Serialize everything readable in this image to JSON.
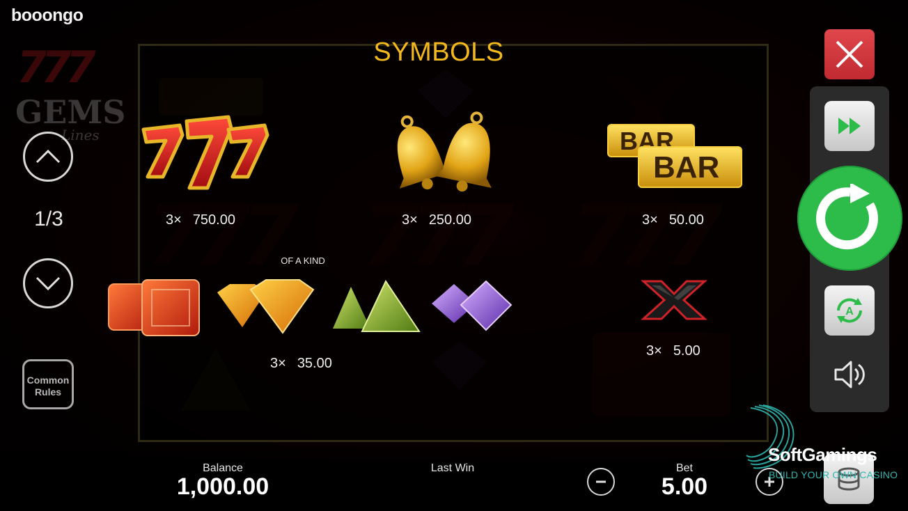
{
  "brand": {
    "provider_logo": "booongo"
  },
  "game_logo": {
    "top": "777",
    "middle": "GEMS",
    "bottom": "Lines"
  },
  "title": "SYMBOLS",
  "navigation": {
    "page_indicator": "1/3",
    "up_icon": "chevron-up-icon",
    "down_icon": "chevron-down-icon",
    "common_rules_line1": "Common",
    "common_rules_line2": "Rules"
  },
  "symbols": [
    {
      "id": "sevens",
      "icon": "sevens-icon",
      "mult": "3×",
      "value": "750.00"
    },
    {
      "id": "bells",
      "icon": "bells-icon",
      "mult": "3×",
      "value": "250.00"
    },
    {
      "id": "bar",
      "icon": "bar-icon",
      "mult": "3×",
      "value": "50.00"
    },
    {
      "id": "gems",
      "icon": "gems-icon",
      "label": "OF A KIND",
      "mult": "3×",
      "value": "35.00"
    },
    {
      "id": "x",
      "icon": "x-icon",
      "mult": "3×",
      "value": "5.00"
    }
  ],
  "bar_symbol": {
    "line1": "BAR",
    "line2": "BAR"
  },
  "controls": {
    "close_icon": "close-icon",
    "fast_forward_icon": "fast-forward-icon",
    "spin_icon": "spin-icon",
    "autoplay_icon": "autoplay-icon",
    "autoplay_letter": "A",
    "sound_icon": "sound-icon"
  },
  "bottom_bar": {
    "balance_label": "Balance",
    "balance_value": "1,000.00",
    "last_win_label": "Last Win",
    "last_win_value": "",
    "bet_label": "Bet",
    "bet_value": "5.00",
    "minus_icon": "minus-icon",
    "plus_icon": "plus-icon",
    "chips_icon": "chips-icon"
  },
  "watermark": {
    "name": "SoftGamings",
    "tagline": "BUILD YOUR OWN CASINO"
  },
  "colors": {
    "title": "#f3b81c",
    "close": "#d9383e",
    "spin": "#2dbb4a",
    "watermark_accent": "#2fb7b0"
  }
}
